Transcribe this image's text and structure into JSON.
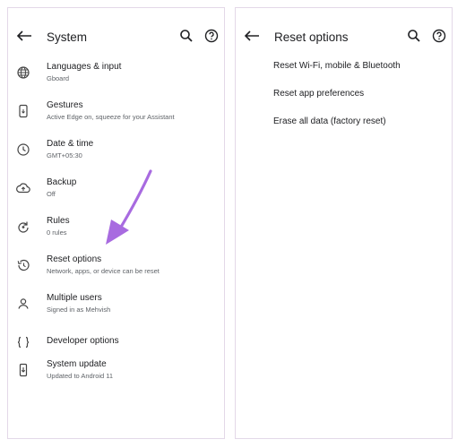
{
  "left": {
    "title": "System",
    "items": [
      {
        "icon": "globe-icon",
        "title": "Languages & input",
        "subtitle": "Gboard"
      },
      {
        "icon": "gestures-icon",
        "title": "Gestures",
        "subtitle": "Active Edge on, squeeze for your Assistant"
      },
      {
        "icon": "clock-icon",
        "title": "Date & time",
        "subtitle": "GMT+05:30"
      },
      {
        "icon": "cloud-upload-icon",
        "title": "Backup",
        "subtitle": "Off"
      },
      {
        "icon": "rules-icon",
        "title": "Rules",
        "subtitle": "0 rules"
      },
      {
        "icon": "history-icon",
        "title": "Reset options",
        "subtitle": "Network, apps, or device can be reset"
      },
      {
        "icon": "person-icon",
        "title": "Multiple users",
        "subtitle": "Signed in as Mehvish"
      },
      {
        "icon": "braces-icon",
        "title": "Developer options",
        "subtitle": ""
      },
      {
        "icon": "system-update-icon",
        "title": "System update",
        "subtitle": "Updated to Android 11"
      }
    ]
  },
  "right": {
    "title": "Reset options",
    "items": [
      "Reset Wi-Fi, mobile & Bluetooth",
      "Reset app preferences",
      "Erase all data (factory reset)"
    ]
  },
  "colors": {
    "accent_arrow": "#a86be0",
    "border": "#e3d8e8",
    "text": "#202124",
    "subtext": "#5f6368"
  }
}
